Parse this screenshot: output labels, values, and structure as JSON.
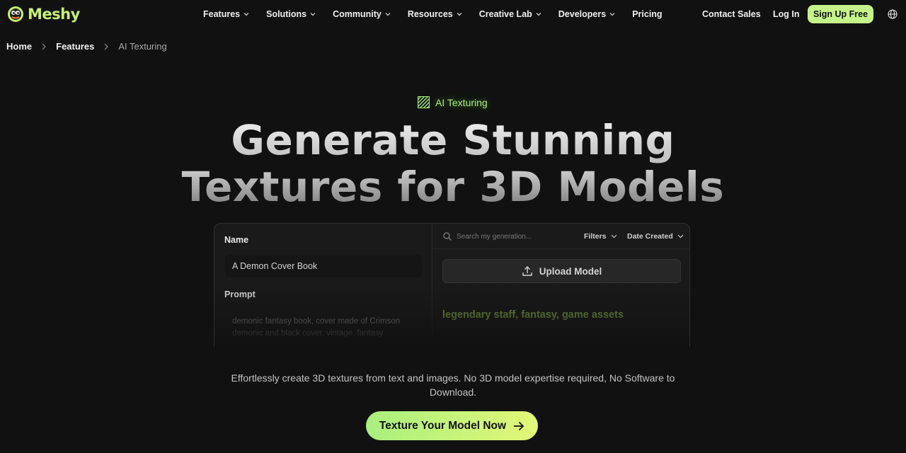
{
  "brand": {
    "name": "Meshy",
    "accent": "#c5f58a"
  },
  "nav": {
    "items": [
      {
        "label": "Features",
        "dropdown": true
      },
      {
        "label": "Solutions",
        "dropdown": true
      },
      {
        "label": "Community",
        "dropdown": true
      },
      {
        "label": "Resources",
        "dropdown": true
      },
      {
        "label": "Creative Lab",
        "dropdown": true
      },
      {
        "label": "Developers",
        "dropdown": true
      },
      {
        "label": "Pricing",
        "dropdown": false
      }
    ],
    "contact_sales": "Contact Sales",
    "login": "Log In",
    "signup": "Sign Up Free",
    "language_icon": "globe-icon"
  },
  "breadcrumb": {
    "home": "Home",
    "section": "Features",
    "current": "AI Texturing"
  },
  "hero": {
    "tag": "AI Texturing",
    "title_line1": "Generate Stunning",
    "title_line2": "Textures for 3D Models",
    "subtext": "Effortlessly create 3D textures from text and images. No 3D model expertise required, No Software to Download.",
    "cta": "Texture Your Model Now"
  },
  "panel": {
    "name_label": "Name",
    "name_value": "A Demon Cover Book",
    "prompt_label": "Prompt",
    "prompt_value": "demonic fantasy book, cover made of Crimson demonic and black cover, vintage, fantasy",
    "search_placeholder": "Search my generation...",
    "filters": "Filters",
    "sort": "Date Created",
    "upload": "Upload Model",
    "generation_prompt": "legendary staff, fantasy, game assets"
  }
}
